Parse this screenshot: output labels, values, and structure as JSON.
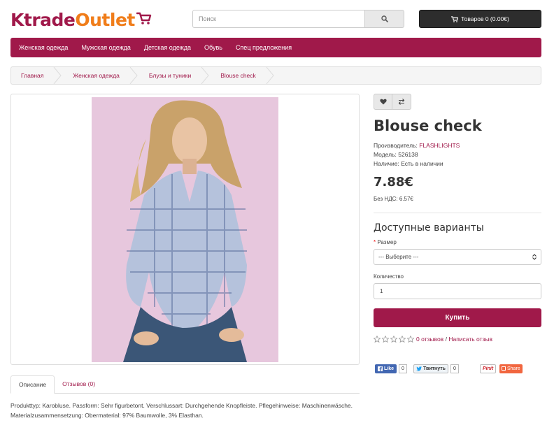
{
  "header": {
    "logo_part1": "Ktrade",
    "logo_part2": "Outlet",
    "search_placeholder": "Поиск",
    "cart_label": "Товаров 0 (0.00€)"
  },
  "menu": [
    {
      "label": "Женская одежда"
    },
    {
      "label": "Мужская одежда"
    },
    {
      "label": "Детская одежда"
    },
    {
      "label": "Обувь"
    },
    {
      "label": "Спец предложения"
    }
  ],
  "breadcrumb": [
    {
      "label": "Главная"
    },
    {
      "label": "Женская одежда"
    },
    {
      "label": "Блузы и туники"
    },
    {
      "label": "Blouse check"
    }
  ],
  "product": {
    "title": "Blouse check",
    "manufacturer_label": "Производитель:",
    "manufacturer": "FLASHLIGHTS",
    "model_label": "Модель:",
    "model": "526138",
    "availability_label": "Наличие:",
    "availability": "Есть в наличии",
    "price": "7.88€",
    "tax_label": "Без НДС:",
    "tax_price": "6.57€"
  },
  "options": {
    "title": "Доступные варианты",
    "required_mark": "*",
    "size_label": "Размер",
    "size_selected": "--- Выберите ---",
    "qty_label": "Количество",
    "qty_value": "1",
    "buy_label": "Купить"
  },
  "rating": {
    "reviews_link": "0 отзывов",
    "separator": "/",
    "write_link": "Написать отзыв",
    "stars": 0,
    "max_stars": 5
  },
  "share": {
    "fb_label": "Like",
    "fb_count": "0",
    "tw_label": "Твитнуть",
    "tw_count": "0",
    "pin_label": "Pinit",
    "share_label": "Share"
  },
  "tabs": [
    {
      "label": "Описание",
      "active": true
    },
    {
      "label": "Отзывов (0)",
      "active": false
    }
  ],
  "description": "Produkttyp: Karobluse. Passform: Sehr figurbetont. Verschlussart: Durchgehende Knopfleiste. Pflegehinweise: Maschinenwäsche. Materialzusammensetzung: Obermaterial: 97% Baumwolle, 3% Elasthan.",
  "colors": {
    "brand": "#a0194a",
    "accent": "#f07d1a",
    "cart_bg": "#2d2d2d"
  }
}
